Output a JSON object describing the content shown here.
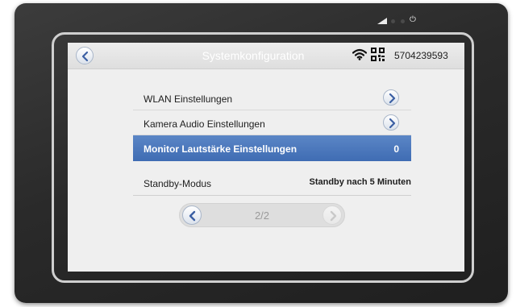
{
  "device": {
    "status_icons": [
      "signal-icon",
      "led-dot-icon",
      "led-dot-icon",
      "power-icon"
    ]
  },
  "header": {
    "back_icon": "chevron-left-icon",
    "title": "Systemkonfiguration",
    "wifi_icon": "wifi-icon",
    "qr_icon": "qr-code-icon",
    "device_id": "5704239593"
  },
  "settings": [
    {
      "label": "WLAN Einstellungen",
      "icon": "chevron-right-icon"
    },
    {
      "label": "Kamera Audio Einstellungen",
      "icon": "chevron-right-icon"
    },
    {
      "label": "Monitor Lautstärke Einstellungen",
      "value": "0",
      "selected": true
    },
    {
      "label": "Standby-Modus",
      "value": "Standby nach 5 Minuten"
    }
  ],
  "pagination": {
    "label": "2/2",
    "prev_icon": "chevron-left-icon",
    "next_icon": "chevron-right-icon"
  },
  "colors": {
    "selected_row": "#4a78bd",
    "screen_background": "#efefef",
    "device_frame": "#2a2a2a"
  }
}
